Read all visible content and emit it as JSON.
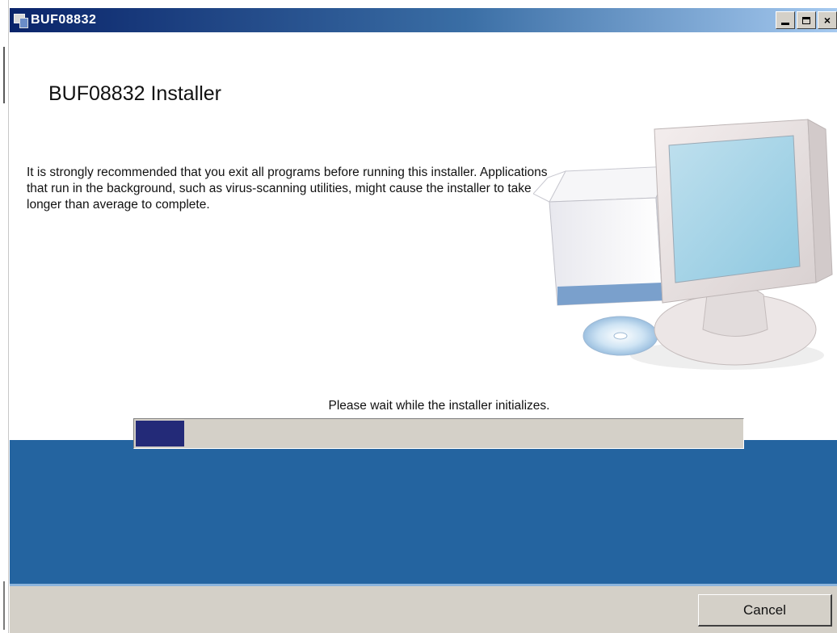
{
  "window": {
    "title": "BUF08832",
    "controls": {
      "minimize": "_",
      "maximize": "□",
      "close": "×"
    }
  },
  "main": {
    "heading": "BUF08832 Installer",
    "intro": "It is strongly recommended that you exit all programs before running this installer. Applications that run in the background, such as virus-scanning utilities, might cause the installer to take longer than average to complete.",
    "status": "Please wait while the installer initializes.",
    "progress_fraction": 0.08
  },
  "footer": {
    "cancel_label": "Cancel"
  },
  "icons": [
    "installer-app-icon",
    "computer-illustration"
  ],
  "colors": {
    "title_bar_start": "#0a246a",
    "band": "#2464a0",
    "progress_fill": "#232a78",
    "dialog_face": "#d4d0c8"
  }
}
